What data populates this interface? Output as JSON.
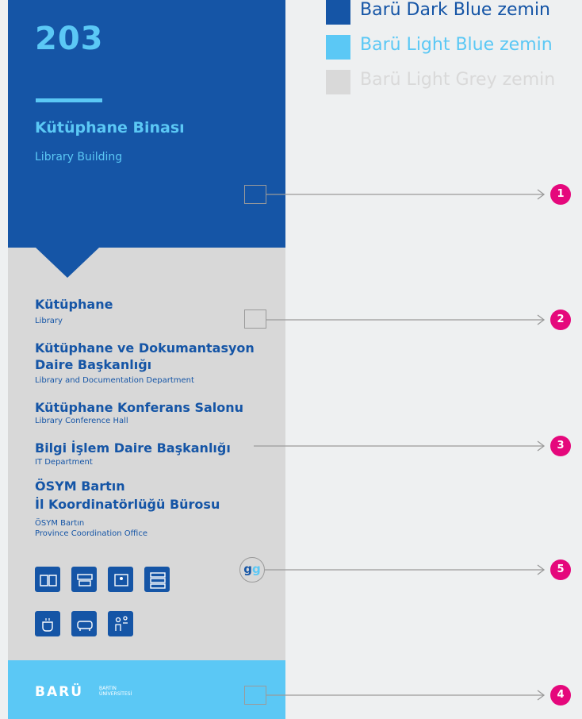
{
  "legend": [
    {
      "label": "Barü Dark Blue zemin",
      "color": "#1555a6"
    },
    {
      "label": "Barü Light Blue zemin",
      "color": "#5bc8f5"
    },
    {
      "label": "Barü Light Grey zemin",
      "color": "#d9d9d9"
    }
  ],
  "sign": {
    "number": "203",
    "building_tr": "Kütüphane Binası",
    "building_en": "Library Building",
    "entries": [
      {
        "tr": [
          "Kütüphane"
        ],
        "en": [
          "Library"
        ]
      },
      {
        "tr": [
          "Kütüphane ve Dokumantasyon",
          "Daire Başkanlığı"
        ],
        "en": [
          "Library and Documentation Department"
        ]
      },
      {
        "tr": [
          "Kütüphane Konferans Salonu"
        ],
        "en": [
          "Library Conference Hall"
        ]
      },
      {
        "tr": [
          "Bilgi İşlem Daire Başkanlığı"
        ],
        "en": [
          "IT Department"
        ]
      },
      {
        "tr": [
          "ÖSYM Bartın",
          "İl Koordinatörlüğü Bürosu"
        ],
        "en": [
          "ÖSYM Bartın",
          "Province Coordination Office"
        ]
      }
    ],
    "icons_row1": [
      "book-icon",
      "classroom-icon",
      "meeting-room-icon",
      "server-icon"
    ],
    "icons_row2": [
      "cafe-icon",
      "lounge-sofa-icon",
      "people-icon"
    ],
    "gg_label": {
      "g1": "g",
      "g2": "g"
    },
    "logo": {
      "wordmark": "BARÜ",
      "line1": "BARTIN",
      "line2": "ÜNİVERSİTESİ"
    }
  },
  "callouts": [
    "1",
    "2",
    "3",
    "5",
    "4"
  ],
  "colors": {
    "dark_blue": "#1555a6",
    "light_blue": "#5bc8f5",
    "light_grey": "#d9d9d9",
    "marker": "#e5087c",
    "background": "#eef0f1"
  }
}
